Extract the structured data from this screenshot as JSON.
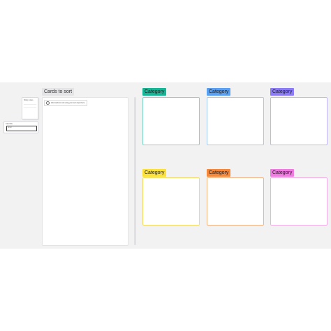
{
  "sidebar": {
    "sticky_note_label": "Sticky notes",
    "card_label": "Card title",
    "card_input": "Enter"
  },
  "sort_area": {
    "title": "Cards to sort",
    "chip_text": "Add cards to sort using your own input here"
  },
  "categories": [
    {
      "label": "Category",
      "color": "#16b596",
      "border": "#7fd6c4"
    },
    {
      "label": "Category",
      "color": "#5aa0f2",
      "border": "#a7c8f3"
    },
    {
      "label": "Category",
      "color": "#8b7cf5",
      "border": "#bfb5f7"
    },
    {
      "label": "Category",
      "color": "#fbe13a",
      "border": "#f4dc6b"
    },
    {
      "label": "Category",
      "color": "#f5883a",
      "border": "#f2b587"
    },
    {
      "label": "Category",
      "color": "#ef7ae0",
      "border": "#f0b0e6"
    }
  ]
}
